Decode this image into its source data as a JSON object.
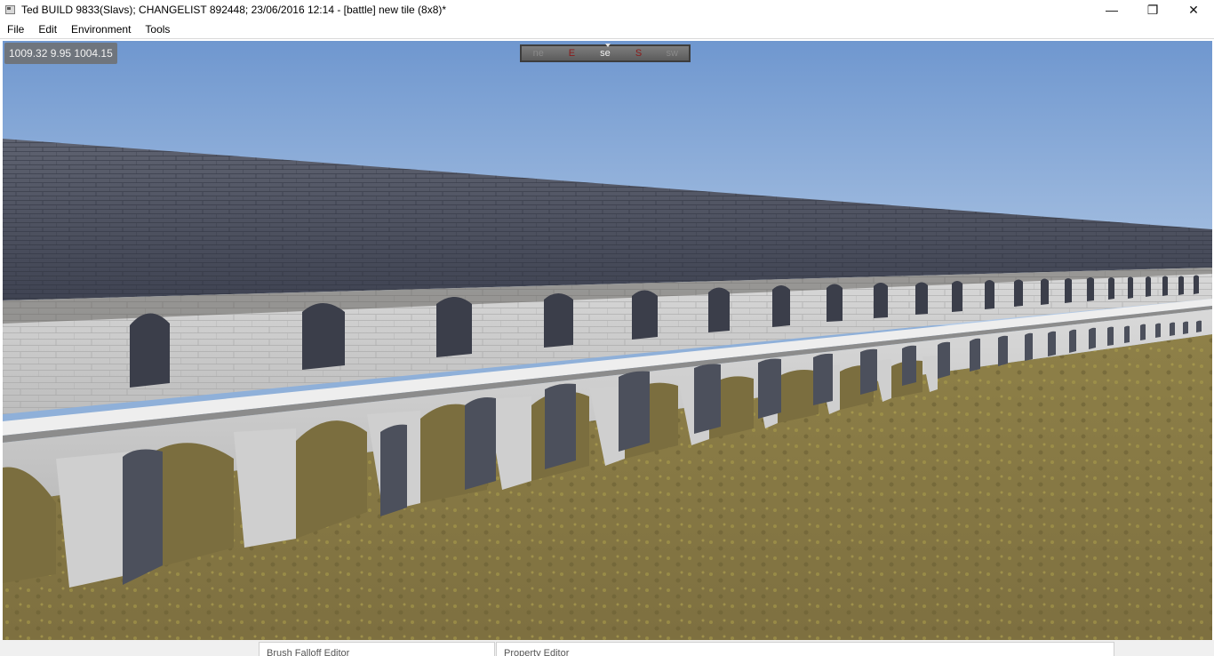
{
  "window": {
    "title": "Ted BUILD 9833(Slavs); CHANGELIST 892448; 23/06/2016 12:14 - [battle] new tile (8x8)*",
    "icon": "app-window-icon",
    "controls": {
      "minimize": "—",
      "restore": "❐",
      "close": "✕"
    }
  },
  "menu": {
    "items": [
      "File",
      "Edit",
      "Environment",
      "Tools"
    ]
  },
  "viewport": {
    "coordinates": "1009.32  9.95 1004.15",
    "compass": {
      "labels": [
        "ne",
        "E",
        "se",
        "S",
        "sw"
      ],
      "current": "se"
    },
    "colors": {
      "sky_top": "#6f97cf",
      "sky_bottom": "#b5cbe6",
      "ground": "#8a7a45",
      "stone": "#d6d6d6",
      "roof": "#4b5060"
    }
  },
  "panels": {
    "brush_falloff_editor": "Brush Falloff Editor",
    "property_editor": "Property Editor"
  }
}
